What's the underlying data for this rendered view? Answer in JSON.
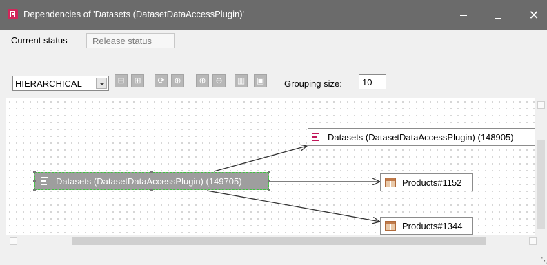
{
  "window": {
    "title": "Dependencies of 'Datasets (DatasetDataAccessPlugin)'",
    "close_glyph": "✕"
  },
  "tabs": [
    {
      "label": "Current status",
      "active": true
    },
    {
      "label": "Release status",
      "active": false
    }
  ],
  "toolbar": {
    "layout_value": "HIERARCHICAL",
    "buttons": [
      {
        "icon": "expand-grid-icon",
        "glyph": "⊞"
      },
      {
        "icon": "collapse-grid-icon",
        "glyph": "⊞"
      },
      {
        "icon": "refresh-icon",
        "glyph": "⟳"
      },
      {
        "icon": "zoom-in-icon",
        "glyph": "⊕"
      },
      {
        "icon": "zoom-fit-icon",
        "glyph": "⊕"
      },
      {
        "icon": "zoom-out-icon",
        "glyph": "⊖"
      },
      {
        "icon": "delete-icon",
        "glyph": "▥"
      },
      {
        "icon": "export-icon",
        "glyph": "▣"
      }
    ],
    "grouping_label": "Grouping size:",
    "grouping_value": "10"
  },
  "graph": {
    "source": {
      "label": "Datasets (DatasetDataAccessPlugin) (149705)",
      "icon": "dataset-icon"
    },
    "targets": [
      {
        "label": "Datasets (DatasetDataAccessPlugin) (148905)",
        "icon": "dataset-icon"
      },
      {
        "label": "Products#1152",
        "icon": "table-icon"
      },
      {
        "label": "Products#1344",
        "icon": "table-icon"
      }
    ]
  },
  "colors": {
    "titlebar": "#6b6b6b",
    "app_icon": "#d2265a",
    "selection_border": "#3ec43e",
    "dataset_icon": "#c2185b"
  }
}
